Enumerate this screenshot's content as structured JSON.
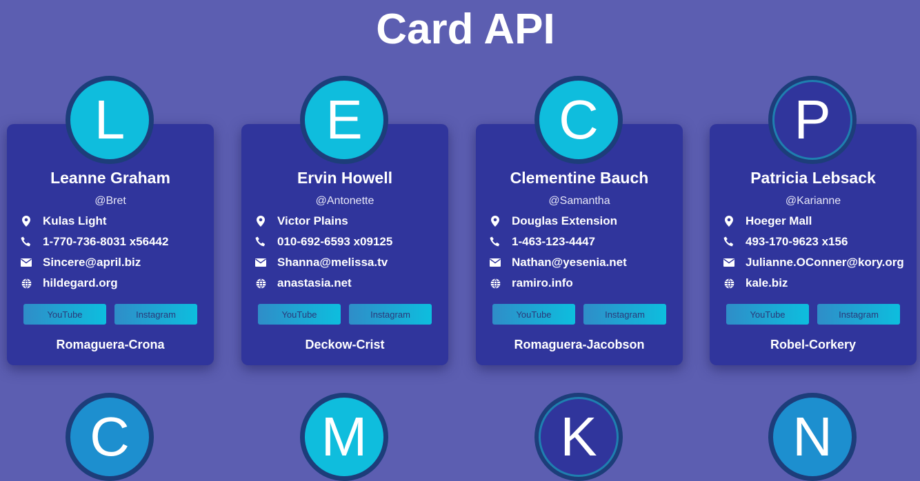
{
  "page": {
    "title": "Card API"
  },
  "cards": [
    {
      "initial": "L",
      "name": "Leanne Graham",
      "username": "@Bret",
      "address": "Kulas Light",
      "phone": "1-770-736-8031 x56442",
      "email": "Sincere@april.biz",
      "website": "hildegard.org",
      "youtube_label": "YouTube",
      "instagram_label": "Instagram",
      "company": "Romaguera-Crona"
    },
    {
      "initial": "E",
      "name": "Ervin Howell",
      "username": "@Antonette",
      "address": "Victor Plains",
      "phone": "010-692-6593 x09125",
      "email": "Shanna@melissa.tv",
      "website": "anastasia.net",
      "youtube_label": "YouTube",
      "instagram_label": "Instagram",
      "company": "Deckow-Crist"
    },
    {
      "initial": "C",
      "name": "Clementine Bauch",
      "username": "@Samantha",
      "address": "Douglas Extension",
      "phone": "1-463-123-4447",
      "email": "Nathan@yesenia.net",
      "website": "ramiro.info",
      "youtube_label": "YouTube",
      "instagram_label": "Instagram",
      "company": "Romaguera-Jacobson"
    },
    {
      "initial": "P",
      "name": "Patricia Lebsack",
      "username": "@Karianne",
      "address": "Hoeger Mall",
      "phone": "493-170-9623 x156",
      "email": "Julianne.OConner@kory.org",
      "website": "kale.biz",
      "youtube_label": "YouTube",
      "instagram_label": "Instagram",
      "company": "Robel-Corkery"
    }
  ],
  "next_row_initials": [
    "C",
    "M",
    "K",
    "N"
  ],
  "icons": {
    "address": "map-pin-icon",
    "phone": "phone-icon",
    "email": "envelope-icon",
    "website": "globe-icon"
  },
  "colors": {
    "background": "#5c5eb1",
    "card": "#30359c",
    "avatar": "#0fbddd",
    "button_start": "#2f8dc8",
    "button_end": "#0dbede"
  }
}
